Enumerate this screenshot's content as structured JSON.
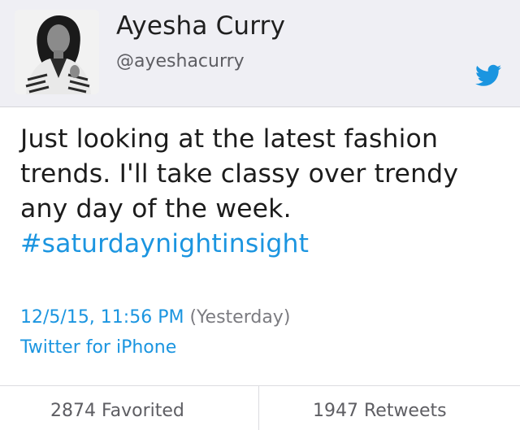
{
  "profile": {
    "name": "Ayesha Curry",
    "handle": "@ayeshacurry",
    "avatar": "profile-photo"
  },
  "icons": {
    "brand": "twitter-bird-icon"
  },
  "tweet": {
    "text": "Just looking at the latest fashion trends. I'll take classy over trendy any day of the week.",
    "hashtag": "#saturdaynightinsight",
    "timestamp": "12/5/15, 11:56 PM",
    "relative_time": "(Yesterday)",
    "source": "Twitter for iPhone"
  },
  "stats": {
    "favorites": "2874 Favorited",
    "retweets": "1947 Retweets"
  },
  "colors": {
    "link": "#1b95e0",
    "header_bg": "#efeff4"
  }
}
